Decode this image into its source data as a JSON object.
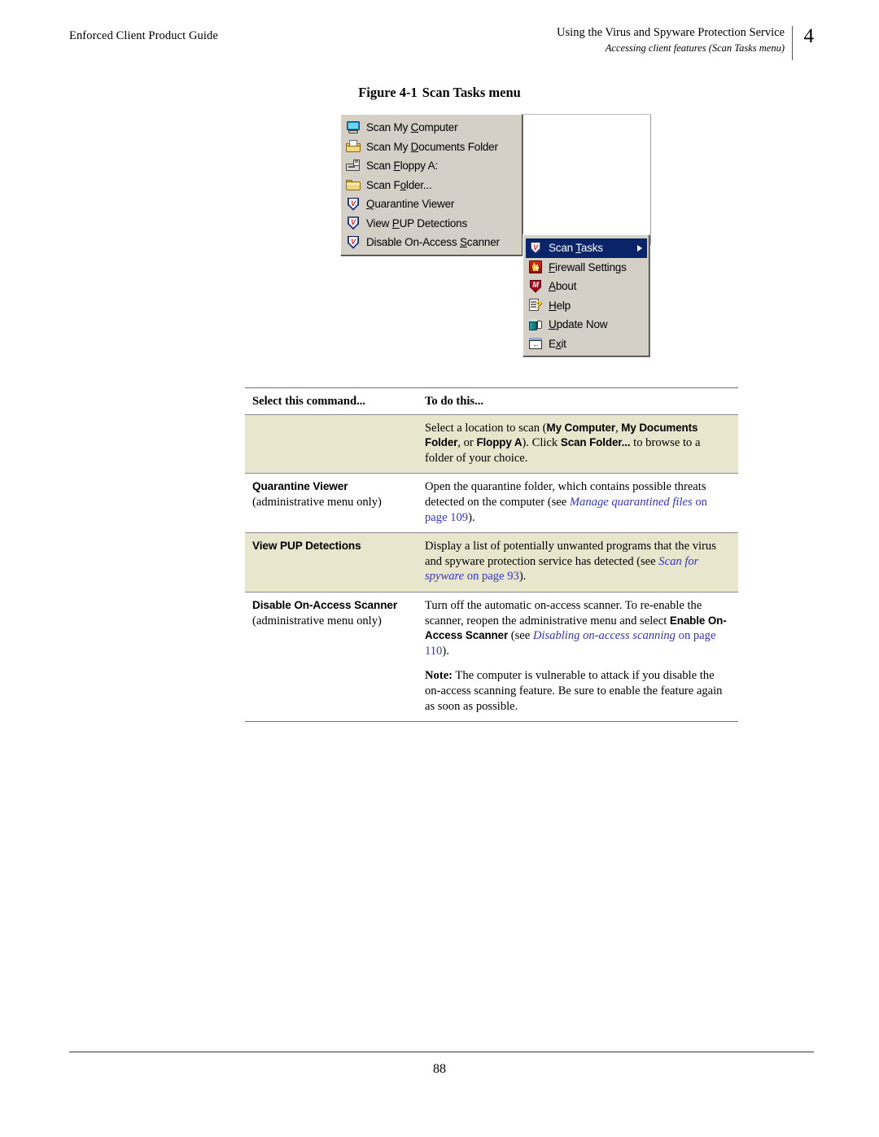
{
  "header": {
    "left_text": "Enforced Client Product Guide",
    "right_title": "Using the Virus and Spyware Protection Service",
    "right_subtitle": "Accessing client features (Scan Tasks menu)",
    "chapter_number": "4"
  },
  "figure": {
    "number": "Figure 4-1",
    "title": "Scan Tasks menu"
  },
  "screenshot": {
    "primary_menu": {
      "items": [
        {
          "label_pre": "Scan My ",
          "accel": "C",
          "label_post": "omputer",
          "icon": "computer-icon",
          "selected": false,
          "submenu": false
        },
        {
          "label_pre": "Scan My ",
          "accel": "D",
          "label_post": "ocuments Folder",
          "icon": "documents-folder-icon",
          "selected": false,
          "submenu": false
        },
        {
          "label_pre": "Scan ",
          "accel": "F",
          "label_post": "loppy A:",
          "icon": "floppy-drive-icon",
          "selected": false,
          "submenu": false
        },
        {
          "label_pre": "Scan F",
          "accel": "o",
          "label_post": "lder...",
          "icon": "folder-icon",
          "selected": false,
          "submenu": false
        },
        {
          "label_pre": "",
          "accel": "Q",
          "label_post": "uarantine Viewer",
          "icon": "shield-icon",
          "selected": false,
          "submenu": false
        },
        {
          "label_pre": "View ",
          "accel": "P",
          "label_post": "UP Detections",
          "icon": "shield-icon",
          "selected": false,
          "submenu": false
        },
        {
          "label_pre": "Disable On-Access ",
          "accel": "S",
          "label_post": "canner",
          "icon": "shield-icon",
          "selected": false,
          "submenu": false
        }
      ]
    },
    "secondary_menu": {
      "items": [
        {
          "label_pre": "Scan ",
          "accel": "T",
          "label_post": "asks",
          "icon": "shield-icon",
          "selected": true,
          "submenu": true
        },
        {
          "label_pre": "",
          "accel": "F",
          "label_post": "irewall Settings",
          "icon": "firewall-flame-icon",
          "selected": false,
          "submenu": false
        },
        {
          "label_pre": "",
          "accel": "A",
          "label_post": "bout",
          "icon": "about-shield-icon",
          "selected": false,
          "submenu": false
        },
        {
          "label_pre": "",
          "accel": "H",
          "label_post": "elp",
          "icon": "help-icon",
          "selected": false,
          "submenu": false
        },
        {
          "label_pre": "",
          "accel": "U",
          "label_post": "pdate Now",
          "icon": "update-icon",
          "selected": false,
          "submenu": false
        },
        {
          "label_pre": "E",
          "accel": "x",
          "label_post": "it",
          "icon": "exit-icon",
          "selected": false,
          "submenu": false
        }
      ]
    }
  },
  "table": {
    "headers": [
      "Select this command...",
      "To do this..."
    ],
    "rows": [
      {
        "shaded": true,
        "command": "",
        "command_sub": "",
        "desc_html": "Select a location to scan (<span class=\"ui\">My Computer</span>, <span class=\"ui\">My Documents Folder</span>, or <span class=\"ui\">Floppy A</span>). Click <span class=\"ui\">Scan Folder...</span> to browse to a folder of your choice."
      },
      {
        "shaded": false,
        "command": "Quarantine Viewer",
        "command_sub": "(administrative menu only)",
        "desc_html": "Open the quarantine folder, which contains possible threats detected on the computer (see <span class=\"xref\">Manage quarantined files</span> <span class=\"xref-pg\">on page 109</span>)."
      },
      {
        "shaded": true,
        "command": "View PUP Detections",
        "command_sub": "",
        "desc_html": "Display a list of potentially unwanted programs that the virus and spyware protection service has detected (see <span class=\"xref\">Scan for spyware</span> <span class=\"xref-pg\">on page 93</span>)."
      },
      {
        "shaded": false,
        "command": "Disable On-Access Scanner",
        "command_sub": "(administrative menu only)",
        "desc_html": "<p>Turn off the automatic on-access scanner. To re-enable the scanner, reopen the administrative menu and select <span class=\"ui\">Enable On-Access Scanner</span> (see <span class=\"xref\">Disabling on-access scanning</span> <span class=\"xref-pg\">on page 110</span>).</p><p><span class=\"note-lbl\">Note:</span> The computer is vulnerable to attack if you disable the on-access scanning feature. Be sure to enable the feature again as soon as possible.</p>"
      }
    ]
  },
  "footer": {
    "page_number": "88"
  }
}
